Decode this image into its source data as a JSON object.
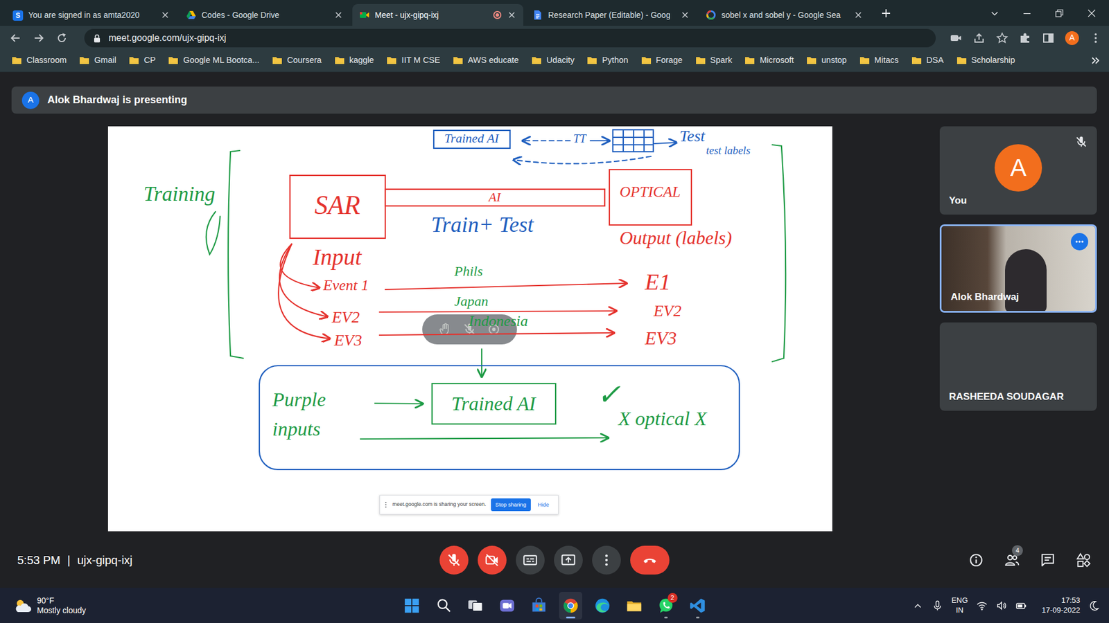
{
  "browser": {
    "tabs": [
      {
        "label": "You are signed in as amta2020",
        "kind": "s-app",
        "icon_text": "S",
        "selected": false,
        "recording": false
      },
      {
        "label": "Codes - Google Drive",
        "kind": "drive",
        "selected": false,
        "recording": false
      },
      {
        "label": "Meet - ujx-gipq-ixj",
        "kind": "meet",
        "selected": true,
        "recording": true
      },
      {
        "label": "Research Paper (Editable) - Goog",
        "kind": "docs",
        "selected": false,
        "recording": false
      },
      {
        "label": "sobel x and sobel y - Google Sea",
        "kind": "google",
        "selected": false,
        "recording": false
      }
    ],
    "url": "meet.google.com/ujx-gipq-ixj",
    "profile_initial": "A",
    "bookmarks": [
      "Classroom",
      "Gmail",
      "CP",
      "Google ML Bootca...",
      "Coursera",
      "kaggle",
      "IIT M CSE",
      "AWS educate",
      "Udacity",
      "Python",
      "Forage",
      "Spark",
      "Microsoft",
      "unstop",
      "Mitacs",
      "DSA",
      "Scholarship"
    ]
  },
  "meet": {
    "banner": {
      "initial": "A",
      "text": "Alok Bhardwaj is presenting"
    },
    "whiteboard": {
      "labels": [
        {
          "text": "Trained AI",
          "color": "#1f5fbf"
        },
        {
          "text": "TT",
          "color": "#1f5fbf"
        },
        {
          "text": "Test",
          "color": "#1f5fbf"
        },
        {
          "text": "test labels",
          "color": "#1f5fbf"
        },
        {
          "text": "Training",
          "color": "#1e9b45"
        },
        {
          "text": "SAR",
          "color": "#e5322d"
        },
        {
          "text": "AI",
          "color": "#e5322d"
        },
        {
          "text": "OPTICAL",
          "color": "#e5322d"
        },
        {
          "text": "Train+ Test",
          "color": "#1f5fbf"
        },
        {
          "text": "Input",
          "color": "#e5322d"
        },
        {
          "text": "Output (labels)",
          "color": "#e5322d"
        },
        {
          "text": "Event 1",
          "color": "#e5322d"
        },
        {
          "text": "EV2",
          "color": "#e5322d"
        },
        {
          "text": "EV3",
          "color": "#e5322d"
        },
        {
          "text": "Phils",
          "color": "#1e9b45"
        },
        {
          "text": "Japan",
          "color": "#1e9b45"
        },
        {
          "text": "Indonesia",
          "color": "#1e9b45"
        },
        {
          "text": "E1",
          "color": "#e5322d"
        },
        {
          "text": "EV2",
          "color": "#e5322d"
        },
        {
          "text": "EV3",
          "color": "#e5322d"
        },
        {
          "text": "Purple inputs",
          "color": "#1e9b45"
        },
        {
          "text": "Trained AI",
          "color": "#1e9b45"
        },
        {
          "text": "✓",
          "color": "#1e9b45"
        },
        {
          "text": "X optical X",
          "color": "#1e9b45"
        }
      ]
    },
    "share_notice": {
      "text": "meet.google.com is sharing your screen.",
      "stop": "Stop sharing",
      "hide": "Hide"
    },
    "participants": [
      {
        "name": "You",
        "initial": "A",
        "kind": "avatar",
        "muted": true,
        "speaking": false
      },
      {
        "name": "Alok Bhardwaj",
        "kind": "video",
        "muted": false,
        "speaking": true
      },
      {
        "name": "RASHEEDA SOUDAGAR",
        "kind": "blank",
        "muted": false,
        "speaking": false
      }
    ],
    "meeting_time": "5:53 PM",
    "separator": "|",
    "meeting_code": "ujx-gipq-ixj",
    "controls": [
      {
        "kind": "mic",
        "off": true
      },
      {
        "kind": "camera",
        "off": true
      },
      {
        "kind": "captions",
        "off": false
      },
      {
        "kind": "present",
        "off": false
      },
      {
        "kind": "more",
        "off": false
      },
      {
        "kind": "leave",
        "off": false
      }
    ],
    "side_controls": [
      {
        "kind": "info"
      },
      {
        "kind": "people",
        "badge": "4"
      },
      {
        "kind": "chat"
      },
      {
        "kind": "activities"
      }
    ]
  },
  "taskbar": {
    "weather": {
      "temp": "90°F",
      "condition": "Mostly cloudy"
    },
    "apps": [
      {
        "kind": "start",
        "running": false,
        "selected": false
      },
      {
        "kind": "search",
        "running": false,
        "selected": false
      },
      {
        "kind": "taskview",
        "running": false,
        "selected": false
      },
      {
        "kind": "teams",
        "running": false,
        "selected": false
      },
      {
        "kind": "store",
        "running": false,
        "selected": false
      },
      {
        "kind": "chrome",
        "running": true,
        "selected": true
      },
      {
        "kind": "edge",
        "running": false,
        "selected": false
      },
      {
        "kind": "explorer",
        "running": false,
        "selected": false
      },
      {
        "kind": "whatsapp",
        "running": true,
        "selected": false,
        "badge": "2"
      },
      {
        "kind": "vscode",
        "running": true,
        "selected": false
      }
    ],
    "tray": {
      "lang": "ENG",
      "region": "IN",
      "time": "17:53",
      "date": "17-09-2022"
    }
  }
}
